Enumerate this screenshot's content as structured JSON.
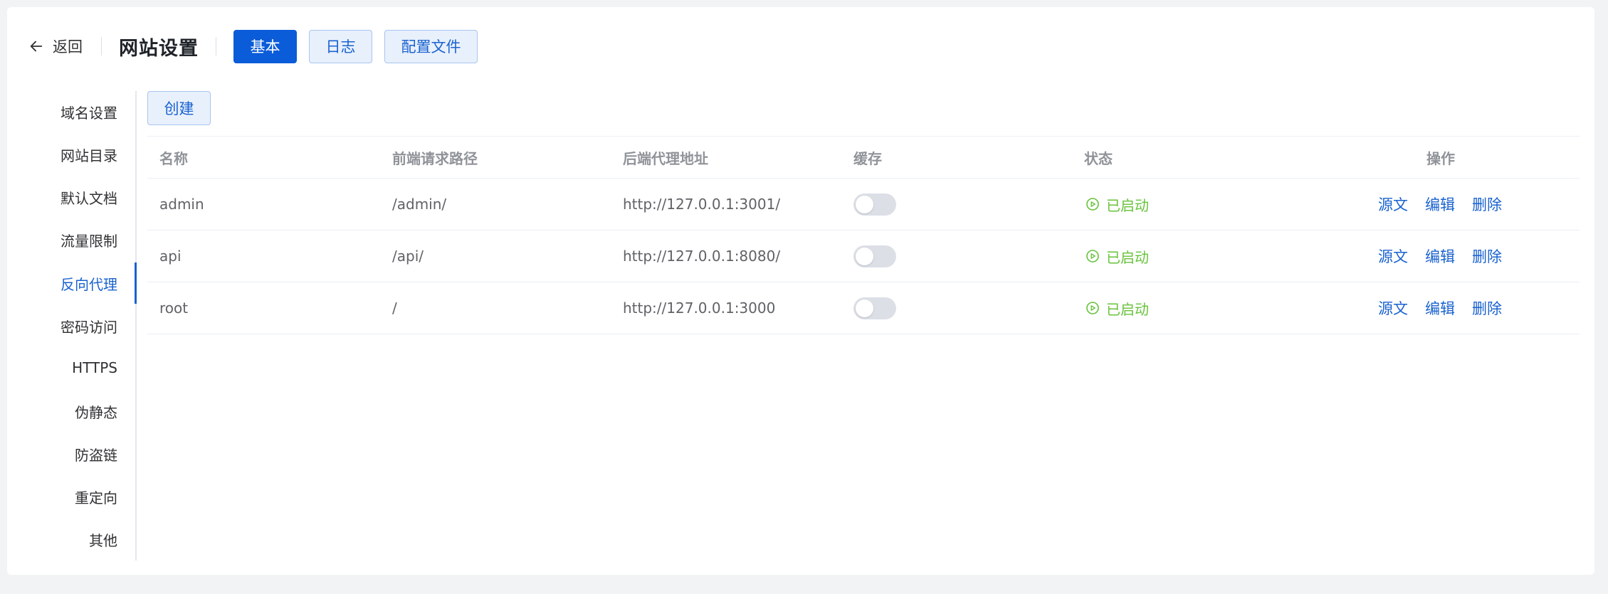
{
  "header": {
    "back_label": "返回",
    "title": "网站设置",
    "tabs": [
      {
        "label": "基本",
        "active": true
      },
      {
        "label": "日志",
        "active": false
      },
      {
        "label": "配置文件",
        "active": false
      }
    ]
  },
  "sidebar": {
    "items": [
      {
        "label": "域名设置"
      },
      {
        "label": "网站目录"
      },
      {
        "label": "默认文档"
      },
      {
        "label": "流量限制"
      },
      {
        "label": "反向代理",
        "active": true
      },
      {
        "label": "密码访问"
      },
      {
        "label": "HTTPS"
      },
      {
        "label": "伪静态"
      },
      {
        "label": "防盗链"
      },
      {
        "label": "重定向"
      },
      {
        "label": "其他"
      }
    ]
  },
  "create_label": "创建",
  "table": {
    "columns": [
      "名称",
      "前端请求路径",
      "后端代理地址",
      "缓存",
      "状态",
      "操作"
    ],
    "rows": [
      {
        "name": "admin",
        "path": "/admin/",
        "backend": "http://127.0.0.1:3001/",
        "cache": false,
        "status": "已启动"
      },
      {
        "name": "api",
        "path": "/api/",
        "backend": "http://127.0.0.1:8080/",
        "cache": false,
        "status": "已启动"
      },
      {
        "name": "root",
        "path": "/",
        "backend": "http://127.0.0.1:3000",
        "cache": false,
        "status": "已启动"
      }
    ],
    "ops": {
      "source": "源文",
      "edit": "编辑",
      "delete": "删除"
    }
  },
  "colors": {
    "primary": "#0a5cd9",
    "link": "#1a62cf",
    "success": "#67c23a"
  }
}
